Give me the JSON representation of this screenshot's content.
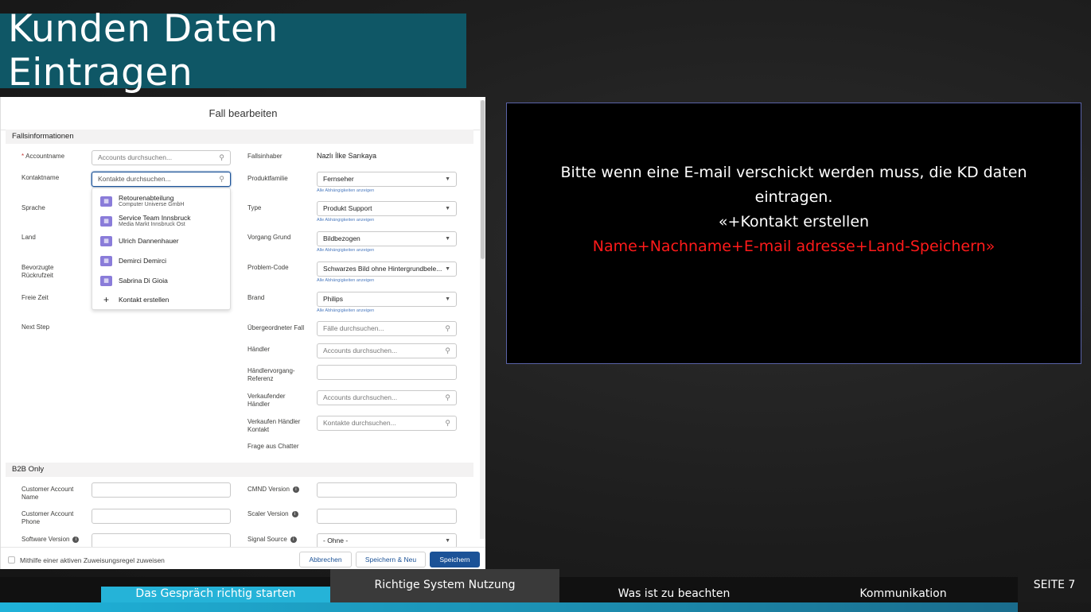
{
  "slide": {
    "title": "Kunden Daten Eintragen",
    "page_label": "SEITE 7"
  },
  "dialog": {
    "title": "Fall bearbeiten",
    "section1": "Fallsinformationen",
    "section2": "B2B Only",
    "left_fields": {
      "accountname": "Accountname",
      "accountname_placeholder": "Accounts durchsuchen...",
      "kontaktname": "Kontaktname",
      "kontaktname_placeholder": "Kontakte durchsuchen...",
      "sprache": "Sprache",
      "land": "Land",
      "rueckrufzeit_1": "Bevorzugte",
      "rueckrufzeit_2": "Rückrufzeit",
      "freie_zeit": "Freie Zeit",
      "next_step": "Next Step"
    },
    "dropdown": {
      "items": [
        {
          "name": "Retourenabteilung",
          "sub": "Computer Universe GmbH"
        },
        {
          "name": "Service Team Innsbruck",
          "sub": "Media Markt Innsbruck Ost"
        },
        {
          "name": "Ulrich Dannenhauer",
          "sub": ""
        },
        {
          "name": "Demirci Demirci",
          "sub": ""
        },
        {
          "name": "Sabrina Di Gioia",
          "sub": ""
        }
      ],
      "create": "Kontakt erstellen"
    },
    "right_fields": {
      "fallinhaber": "Fallsinhaber",
      "fallinhaber_value": "Nazlı İlke Sarıkaya",
      "produktfamilie": "Produktfamilie",
      "produktfamilie_value": "Fernseher",
      "type": "Type",
      "type_value": "Produkt Support",
      "vorgang_grund": "Vorgang Grund",
      "vorgang_grund_value": "Bildbezogen",
      "problem_code": "Problem-Code",
      "problem_code_value": "Schwarzes Bild ohne Hintergrundbele...",
      "brand": "Brand",
      "brand_value": "Philips",
      "dependency_link": "Alle Abhängigkeiten anzeigen",
      "uebergeordneter_fall": "Übergeordneter Fall",
      "uebergeordneter_fall_placeholder": "Fälle durchsuchen...",
      "haendler": "Händler",
      "haendler_placeholder": "Accounts durchsuchen...",
      "haendlervorgang_1": "Händlervorgang-",
      "haendlervorgang_2": "Referenz",
      "verkaufender_haendler_1": "Verkaufender",
      "verkaufender_haendler_2": "Händler",
      "verkaufender_haendler_placeholder": "Accounts durchsuchen...",
      "verkaufen_haendler_kontakt_1": "Verkaufen Händler",
      "verkaufen_haendler_kontakt_2": "Kontakt",
      "verkaufen_haendler_kontakt_placeholder": "Kontakte durchsuchen...",
      "frage_aus_chatter": "Frage aus Chatter"
    },
    "b2b": {
      "customer_account_name_1": "Customer Account",
      "customer_account_name_2": "Name",
      "customer_account_phone_1": "Customer Account",
      "customer_account_phone_2": "Phone",
      "software_version": "Software Version",
      "cmnd_version": "CMND Version",
      "scaler_version": "Scaler Version",
      "signal_source": "Signal Source",
      "signal_source_value": "- Ohne -"
    },
    "footer": {
      "checkbox_label": "Mithilfe einer aktiven Zuweisungsregel zuweisen",
      "cancel": "Abbrechen",
      "save_new": "Speichern & Neu",
      "save": "Speichern"
    }
  },
  "note": {
    "line1": "Bitte wenn eine E-mail verschickt werden muss, die KD daten",
    "line2": "eintragen.",
    "line3": "«+Kontakt erstellen",
    "line4": "Name+Nachname+E-mail adresse+Land-Speichern»"
  },
  "nav": {
    "tab1": "Das Gespräch richtig starten",
    "tab2": "Richtige System Nutzung",
    "tab3": "Was ist zu beachten",
    "tab4": "Kommunikation"
  },
  "colors": {
    "title_bg": "#0f5766",
    "accent": "#25b3d8",
    "note_red": "#ff1a1a",
    "sf_blue": "#1b5297"
  }
}
